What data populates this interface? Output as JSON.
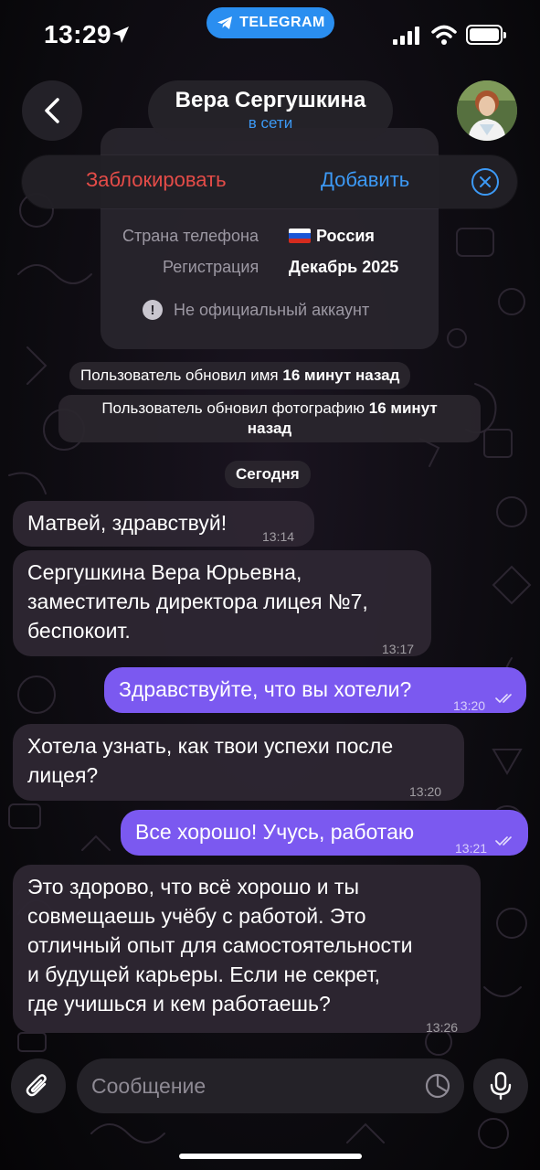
{
  "status_bar": {
    "time": "13:29",
    "pill_label": "TELEGRAM"
  },
  "header": {
    "contact_name": "Вера Сергушкина",
    "status": "в сети"
  },
  "action_bar": {
    "block_label": "Заблокировать",
    "add_label": "Добавить"
  },
  "info_card": {
    "country_label": "Страна телефона",
    "country_value": "Россия",
    "registration_label": "Регистрация",
    "registration_value": "Декабрь 2025",
    "unofficial_label": "Не официальный аккаунт"
  },
  "service_messages": {
    "name_update_text": "Пользователь обновил имя",
    "name_update_time": "16 минут назад",
    "photo_update_text": "Пользователь обновил фотографию",
    "photo_update_time_1": "16 минут",
    "photo_update_time_2": "назад",
    "date_label": "Сегодня"
  },
  "messages": [
    {
      "direction": "in",
      "lines": [
        "Матвей, здравствуй!"
      ],
      "time": "13:14"
    },
    {
      "direction": "in",
      "lines": [
        "Сергушкина Вера Юрьевна,",
        "заместитель директора лицея №7,",
        "беспокоит."
      ],
      "time": "13:17"
    },
    {
      "direction": "out",
      "lines": [
        "Здравствуйте, что вы хотели?"
      ],
      "time": "13:20",
      "read": true
    },
    {
      "direction": "in",
      "lines": [
        "Хотела узнать, как твои успехи после",
        "лицея?"
      ],
      "time": "13:20"
    },
    {
      "direction": "out",
      "lines": [
        "Все хорошо! Учусь, работаю"
      ],
      "time": "13:21",
      "read": true
    },
    {
      "direction": "in",
      "lines": [
        "Это здорово, что всё хорошо и ты",
        "совмещаешь учёбу с работой. Это",
        "отличный опыт для самостоятельности",
        "и будущей карьеры. Если не секрет,",
        "где учишься и кем работаешь?"
      ],
      "time": "13:26"
    }
  ],
  "composer": {
    "placeholder": "Сообщение"
  },
  "colors": {
    "accent_blue": "#3c99f5",
    "danger_red": "#e54c48",
    "outgoing_bubble": "#7b59f0",
    "incoming_bubble": "#2e2632"
  },
  "icons": {
    "back": "chevron-left-icon",
    "attach": "paperclip-icon",
    "sticker": "sticker-icon",
    "mic": "microphone-icon",
    "close": "close-icon"
  }
}
